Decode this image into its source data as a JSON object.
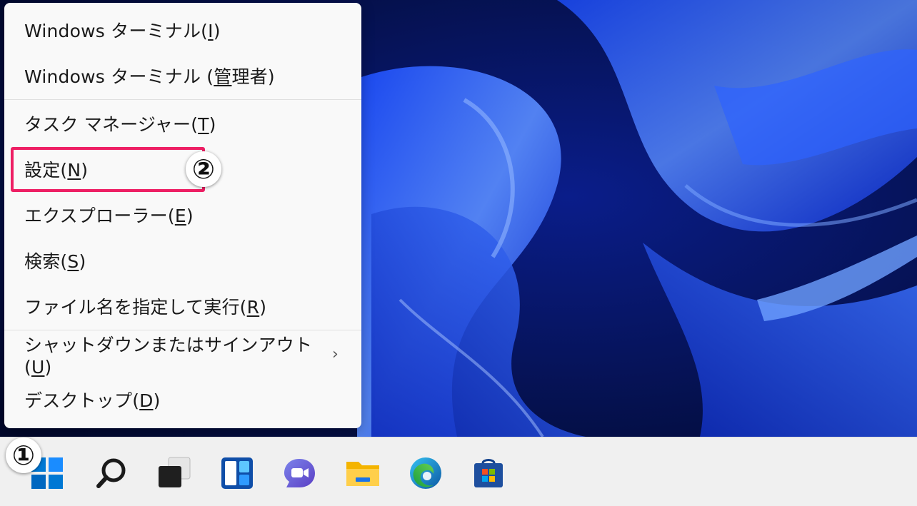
{
  "menu": {
    "items": [
      {
        "label": "Windows ターミナル(",
        "accel": "I",
        "close": ")"
      },
      {
        "label": "Windows ターミナル (",
        "accel": "管",
        "close": "理者)"
      },
      {
        "label": "タスク マネージャー(",
        "accel": "T",
        "close": ")"
      },
      {
        "label": "設定(",
        "accel": "N",
        "close": ")"
      },
      {
        "label": "エクスプローラー(",
        "accel": "E",
        "close": ")"
      },
      {
        "label": "検索(",
        "accel": "S",
        "close": ")"
      },
      {
        "label": "ファイル名を指定して実行(",
        "accel": "R",
        "close": ")"
      },
      {
        "label": "シャットダウンまたはサインアウト(",
        "accel": "U",
        "close": ")",
        "chevron": "›"
      },
      {
        "label": "デスクトップ(",
        "accel": "D",
        "close": ")"
      }
    ]
  },
  "annotations": {
    "step1": "①",
    "step2": "②",
    "highlight_color": "#ee1f64"
  },
  "taskbar": {
    "icons": [
      "windows-start-icon",
      "search-icon",
      "task-view-icon",
      "widgets-icon",
      "teams-chat-icon",
      "file-explorer-icon",
      "edge-icon",
      "store-icon"
    ]
  },
  "colors": {
    "accent": "#0067c0",
    "wallpaper_dark": "#000a3a",
    "wallpaper_bright": "#2f6bff"
  }
}
